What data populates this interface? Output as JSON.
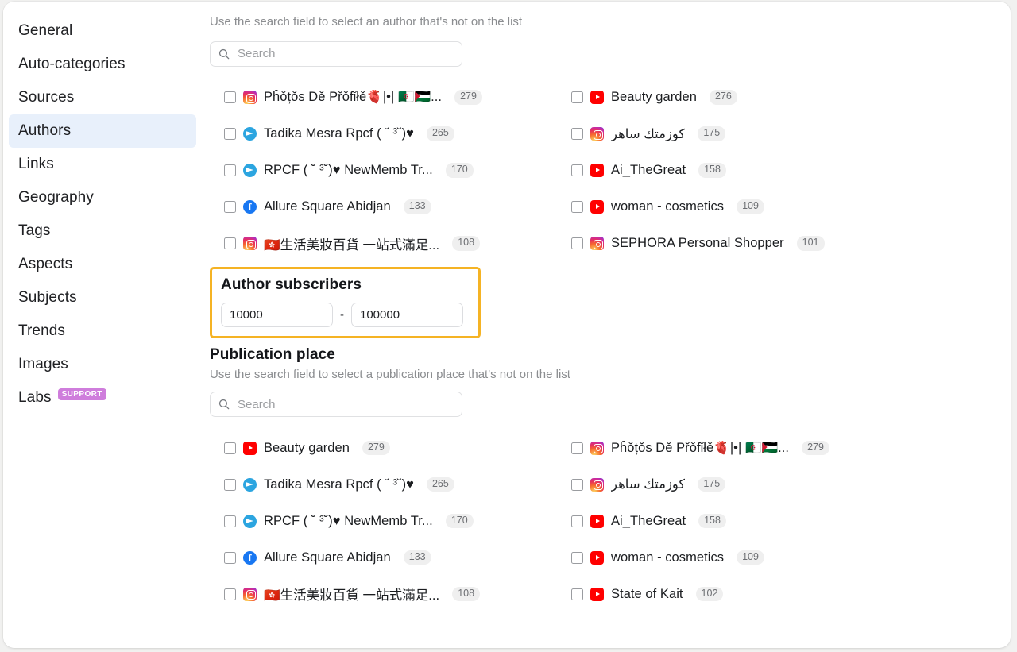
{
  "sidebar": {
    "items": [
      {
        "label": "General",
        "active": false
      },
      {
        "label": "Auto-categories",
        "active": false
      },
      {
        "label": "Sources",
        "active": false
      },
      {
        "label": "Authors",
        "active": true
      },
      {
        "label": "Links",
        "active": false
      },
      {
        "label": "Geography",
        "active": false
      },
      {
        "label": "Tags",
        "active": false
      },
      {
        "label": "Aspects",
        "active": false
      },
      {
        "label": "Subjects",
        "active": false
      },
      {
        "label": "Trends",
        "active": false
      },
      {
        "label": "Images",
        "active": false
      },
      {
        "label": "Labs",
        "active": false,
        "badge": "SUPPORT"
      }
    ],
    "labs_badge": "SUPPORT"
  },
  "authors_section": {
    "hint": "Use the search field to select an author that's not on the list",
    "search_placeholder": "Search",
    "search_value": "",
    "left_column": [
      {
        "platform": "instagram",
        "name": "Pȟǒțǒs Dě Přǒfǐłě🫀|•| 🇩🇿🇵🇸...",
        "count": "279"
      },
      {
        "platform": "telegram",
        "name": "Tadika Mesra Rpcf ( ˘ ³˘)♥",
        "count": "265"
      },
      {
        "platform": "telegram",
        "name": "RPCF ( ˘ ³˘)♥ NewMemb Tr...",
        "count": "170"
      },
      {
        "platform": "facebook",
        "name": "Allure Square Abidjan",
        "count": "133"
      },
      {
        "platform": "instagram",
        "name": "🇭🇰生活美妝百貨 一站式滿足...",
        "count": "108"
      }
    ],
    "right_column": [
      {
        "platform": "youtube",
        "name": "Beauty garden",
        "count": "276"
      },
      {
        "platform": "instagram",
        "name": "كوزمتك ساهر",
        "count": "175",
        "rtl": true
      },
      {
        "platform": "youtube",
        "name": "Ai_TheGreat",
        "count": "158"
      },
      {
        "platform": "youtube",
        "name": "woman - cosmetics",
        "count": "109"
      },
      {
        "platform": "instagram",
        "name": "SEPHORA Personal Shopper",
        "count": "101"
      }
    ]
  },
  "author_subscribers": {
    "title": "Author subscribers",
    "min_value": "10000",
    "max_value": "100000",
    "separator": "-",
    "highlight_color": "#f5b324"
  },
  "publication_place": {
    "title": "Publication place",
    "hint": "Use the search field to select a publication place that's not on the list",
    "search_placeholder": "Search",
    "search_value": "",
    "left_column": [
      {
        "platform": "youtube",
        "name": "Beauty garden",
        "count": "279"
      },
      {
        "platform": "telegram",
        "name": "Tadika Mesra Rpcf ( ˘ ³˘)♥",
        "count": "265"
      },
      {
        "platform": "telegram",
        "name": "RPCF ( ˘ ³˘)♥ NewMemb Tr...",
        "count": "170"
      },
      {
        "platform": "facebook",
        "name": "Allure Square Abidjan",
        "count": "133"
      },
      {
        "platform": "instagram",
        "name": "🇭🇰生活美妝百貨 一站式滿足...",
        "count": "108"
      }
    ],
    "right_column": [
      {
        "platform": "instagram",
        "name": "Pȟǒțǒs Dě Přǒfǐłě🫀|•| 🇩🇿🇵🇸...",
        "count": "279"
      },
      {
        "platform": "instagram",
        "name": "كوزمتك ساهر",
        "count": "175",
        "rtl": true
      },
      {
        "platform": "youtube",
        "name": "Ai_TheGreat",
        "count": "158"
      },
      {
        "platform": "youtube",
        "name": "woman - cosmetics",
        "count": "109"
      },
      {
        "platform": "youtube",
        "name": "State of Kait",
        "count": "102"
      }
    ]
  },
  "icons": {
    "search": "search-icon",
    "checkbox": "checkbox-icon"
  }
}
